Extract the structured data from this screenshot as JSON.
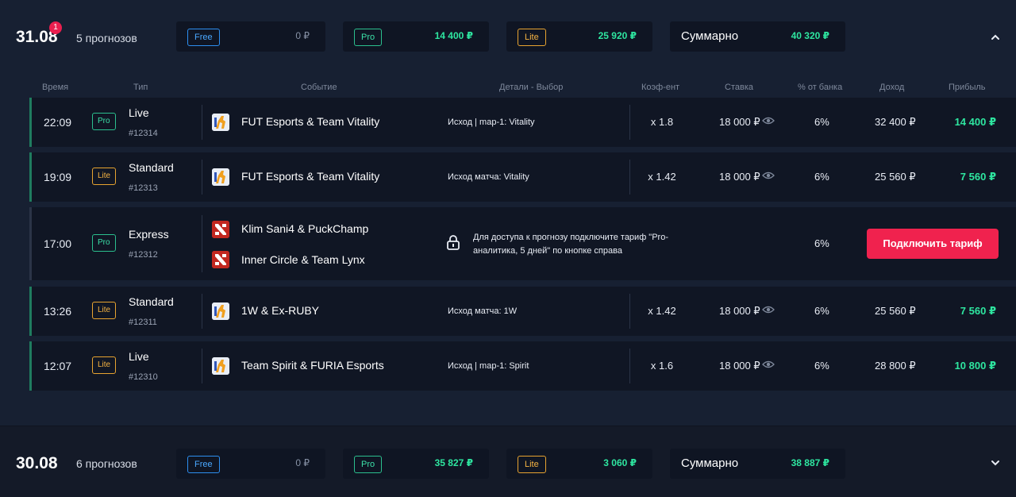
{
  "days": [
    {
      "date": "31.08",
      "badge": "1",
      "count": "5 прогнозов",
      "summary": {
        "free": {
          "tag": "Free",
          "value": "0 ₽"
        },
        "pro": {
          "tag": "Pro",
          "value": "14 400 ₽"
        },
        "lite": {
          "tag": "Lite",
          "value": "25 920 ₽"
        },
        "total": {
          "label": "Суммарно",
          "value": "40 320 ₽"
        }
      },
      "toggle_icon": "chevron-up-icon"
    },
    {
      "date": "30.08",
      "count": "6 прогнозов",
      "summary": {
        "free": {
          "tag": "Free",
          "value": "0 ₽"
        },
        "pro": {
          "tag": "Pro",
          "value": "35 827 ₽"
        },
        "lite": {
          "tag": "Lite",
          "value": "3 060 ₽"
        },
        "total": {
          "label": "Суммарно",
          "value": "38 887 ₽"
        }
      },
      "toggle_icon": "chevron-down-icon"
    }
  ],
  "columns": [
    "Время",
    "Тип",
    "Событие",
    "Детали - Выбор",
    "Коэф-ент",
    "Ставка",
    "% от банка",
    "Доход",
    "Прибыль"
  ],
  "rows": [
    {
      "time": "22:09",
      "tier": "Pro",
      "kind": "Live",
      "code": "#12314",
      "game": "cs-icon",
      "event": "FUT Esports & Team Vitality",
      "detail": "Исход | map-1: Vitality",
      "coef": "x 1.8",
      "stake": "18 000 ₽",
      "pct": "6%",
      "income": "32 400 ₽",
      "profit": "14 400 ₽"
    },
    {
      "time": "19:09",
      "tier": "Lite",
      "kind": "Standard",
      "code": "#12313",
      "game": "cs-icon",
      "event": "FUT Esports & Team Vitality",
      "detail": "Исход матча: Vitality",
      "coef": "x 1.42",
      "stake": "18 000 ₽",
      "pct": "6%",
      "income": "25 560 ₽",
      "profit": "7 560 ₽"
    },
    {
      "time": "17:00",
      "tier": "Pro",
      "kind": "Express",
      "code": "#12312",
      "game": "dota-icon",
      "events": [
        "Klim Sani4 & PuckChamp",
        "Inner Circle & Team Lynx"
      ],
      "lock_text": "Для доступа к прогнозу подключите тариф \"Pro-аналитика, 5 дней\" по кнопке справа",
      "pct": "6%",
      "button": "Подключить тариф"
    },
    {
      "time": "13:26",
      "tier": "Lite",
      "kind": "Standard",
      "code": "#12311",
      "game": "cs-icon",
      "event": "1W & Ex-RUBY",
      "detail": "Исход матча: 1W",
      "coef": "x 1.42",
      "stake": "18 000 ₽",
      "pct": "6%",
      "income": "25 560 ₽",
      "profit": "7 560 ₽"
    },
    {
      "time": "12:07",
      "tier": "Lite",
      "kind": "Live",
      "code": "#12310",
      "game": "cs-icon",
      "event": "Team Spirit & FURIA Esports",
      "detail": "Исход | map-1: Spirit",
      "coef": "x 1.6",
      "stake": "18 000 ₽",
      "pct": "6%",
      "income": "28 800 ₽",
      "profit": "10 800 ₽"
    }
  ]
}
